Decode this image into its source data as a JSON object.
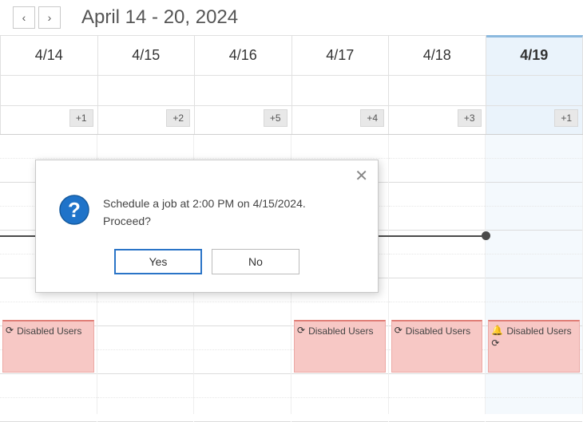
{
  "header": {
    "title": "April 14 - 20, 2024",
    "prev_glyph": "‹",
    "next_glyph": "›"
  },
  "days": [
    {
      "label": "4/14",
      "count": "+1",
      "today": false,
      "event": {
        "label": "Disabled Users",
        "icons": [
          "refresh"
        ]
      }
    },
    {
      "label": "4/15",
      "count": "+2",
      "today": false,
      "event": null
    },
    {
      "label": "4/16",
      "count": "+5",
      "today": false,
      "event": null
    },
    {
      "label": "4/17",
      "count": "+4",
      "today": false,
      "event": {
        "label": "Disabled Users",
        "icons": [
          "refresh"
        ]
      }
    },
    {
      "label": "4/18",
      "count": "+3",
      "today": false,
      "event": {
        "label": "Disabled Users",
        "icons": [
          "refresh"
        ]
      }
    },
    {
      "label": "4/19",
      "count": "+1",
      "today": true,
      "event": {
        "label": "Disabled Users",
        "icons": [
          "bell",
          "refresh"
        ]
      }
    }
  ],
  "modal": {
    "message_line1": "Schedule a job at 2:00 PM on 4/15/2024.",
    "message_line2": "Proceed?",
    "yes_label": "Yes",
    "no_label": "No",
    "close_glyph": "✕"
  },
  "icons": {
    "refresh": "⟳",
    "bell": "🔔"
  }
}
